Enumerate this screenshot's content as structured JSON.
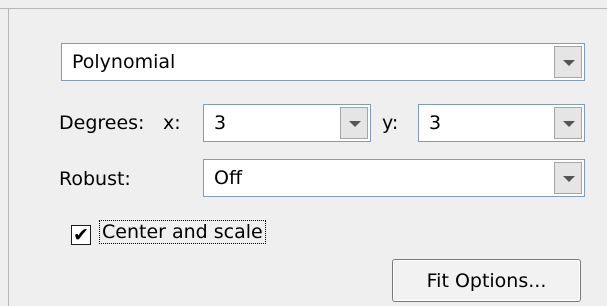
{
  "fit_type": {
    "selected": "Polynomial"
  },
  "degrees": {
    "label": "Degrees:",
    "x_label": "x:",
    "x_value": "3",
    "y_label": "y:",
    "y_value": "3"
  },
  "robust": {
    "label": "Robust:",
    "selected": "Off"
  },
  "center_scale": {
    "checked": true,
    "label": "Center and scale"
  },
  "fit_options_button": {
    "label": "Fit Options..."
  },
  "icons": {
    "dropdown": "chevron-down-icon",
    "check": "checkmark-icon"
  }
}
